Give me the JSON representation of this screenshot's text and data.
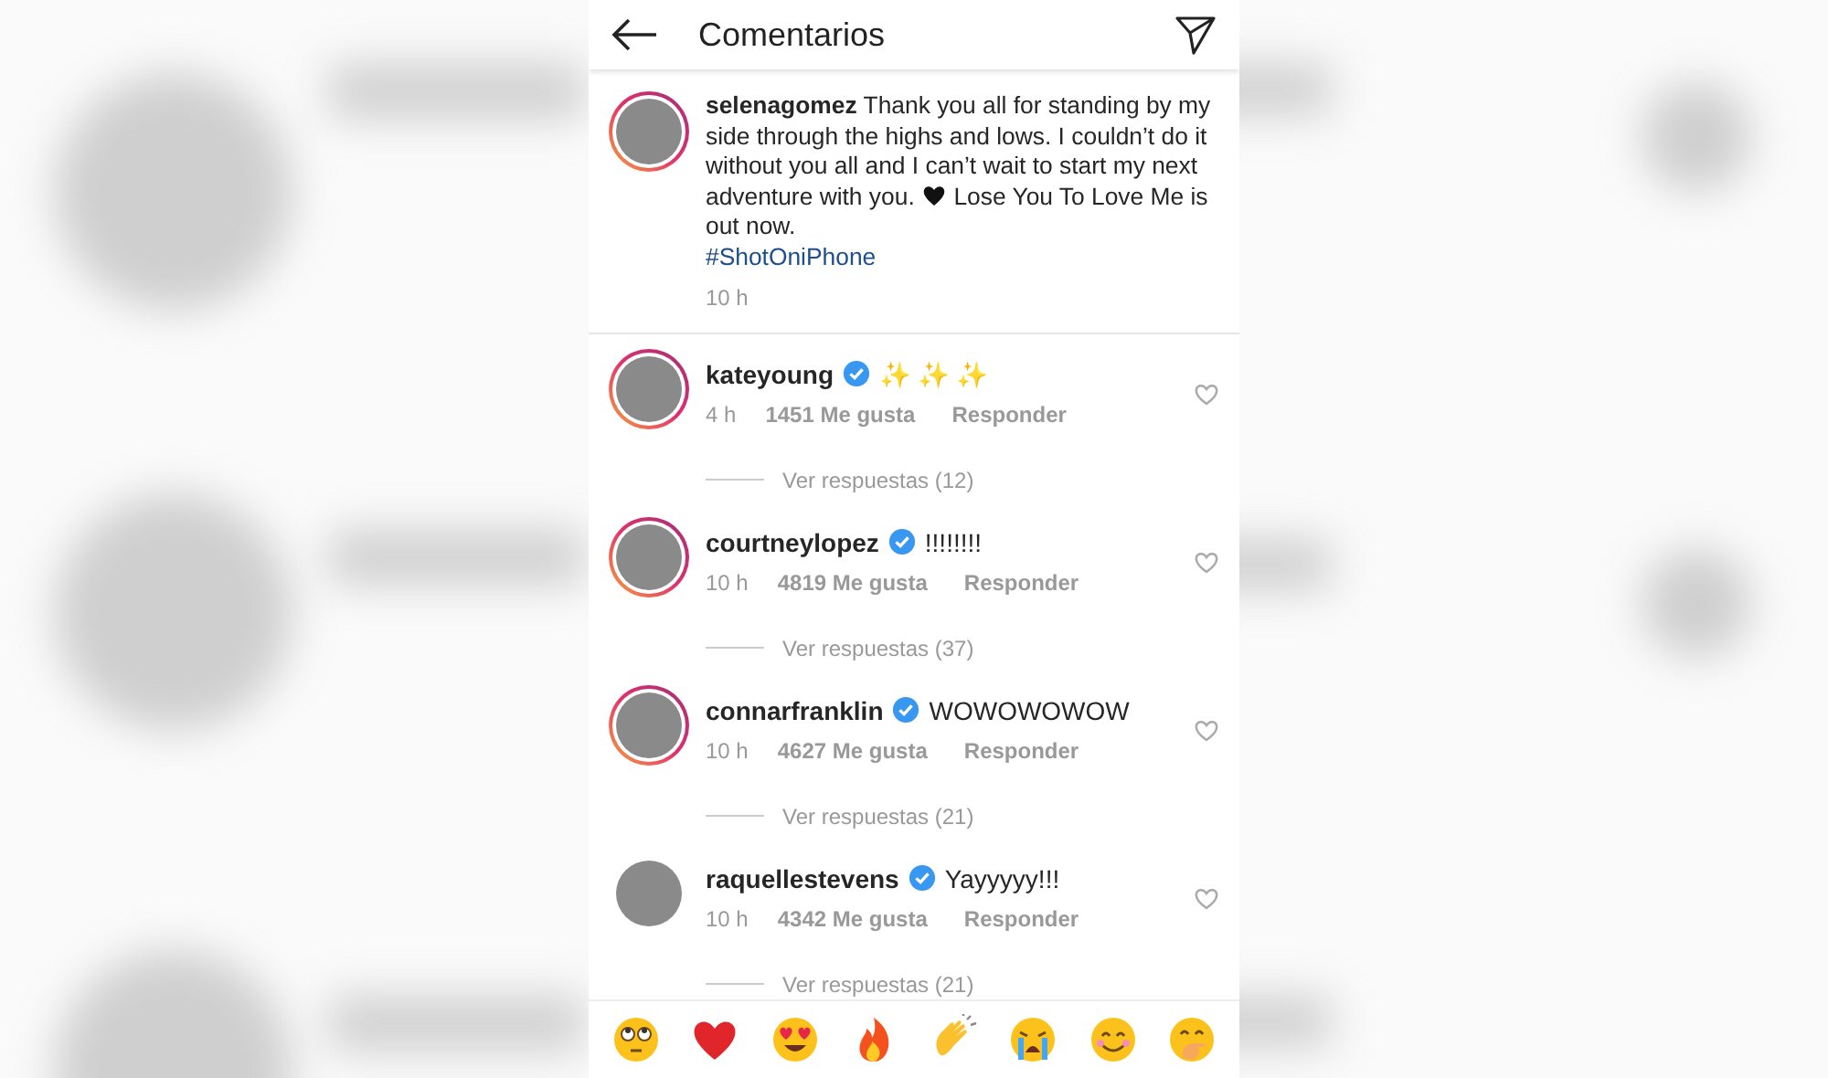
{
  "header": {
    "title": "Comentarios"
  },
  "caption": {
    "username": "selenagomez",
    "story_ring": true,
    "text_before": "Thank you all for standing by my side through the highs and lows. I couldn’t do it without you all and I can’t wait to start my next adventure with you.",
    "text_after": "Lose You To Love Me is out now.",
    "hashtag": "#ShotOniPhone",
    "time": "10 h"
  },
  "comments": [
    {
      "username": "kateyoung",
      "verified": true,
      "story_ring": true,
      "text": "✨ ✨ ✨",
      "kind": "sparkles",
      "time": "4 h",
      "likes": "1451 Me gusta",
      "reply": "Responder",
      "replies": "Ver respuestas (12)"
    },
    {
      "username": "courtneylopez",
      "verified": true,
      "story_ring": true,
      "text": "!!!!!!!!",
      "kind": "plain",
      "time": "10 h",
      "likes": "4819 Me gusta",
      "reply": "Responder",
      "replies": "Ver respuestas (37)"
    },
    {
      "username": "connarfranklin",
      "verified": true,
      "story_ring": true,
      "text": "WOWOWOWOW",
      "kind": "plain",
      "time": "10 h",
      "likes": "4627 Me gusta",
      "reply": "Responder",
      "replies": "Ver respuestas (21)"
    },
    {
      "username": "raquellestevens",
      "verified": true,
      "story_ring": false,
      "text": "Yayyyyy!!!",
      "kind": "plain",
      "time": "10 h",
      "likes": "4342 Me gusta",
      "reply": "Responder",
      "replies": "Ver respuestas (21)"
    }
  ],
  "reactions": [
    {
      "kind": "eye-roll"
    },
    {
      "kind": "heart"
    },
    {
      "kind": "heart-eyes"
    },
    {
      "kind": "fire"
    },
    {
      "kind": "clap"
    },
    {
      "kind": "crying"
    },
    {
      "kind": "smile"
    },
    {
      "kind": "hand-over-mouth"
    }
  ]
}
